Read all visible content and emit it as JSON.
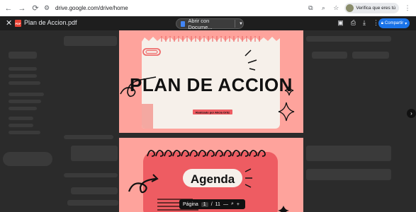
{
  "browser": {
    "url": "drive.google.com/drive/home",
    "verify_label": "Verifica que eres tú"
  },
  "viewer": {
    "file_title": "Plan de Accion.pdf",
    "pdf_badge": "PDF",
    "open_with_label": "Abrir con Docume...",
    "share_label": "Compartir"
  },
  "slide1": {
    "title": "PLAN DE ACCION",
    "subtitle": "Realizado por Alicia Ortiz"
  },
  "slide2": {
    "title": "Agenda"
  },
  "pager": {
    "label": "Página",
    "current": "1",
    "separator": "/",
    "total": "11"
  },
  "colors": {
    "slide_bg": "#fea39c",
    "slide_card": "#f6f0ea",
    "accent_pink": "#ee5c62",
    "ink": "#111111"
  }
}
